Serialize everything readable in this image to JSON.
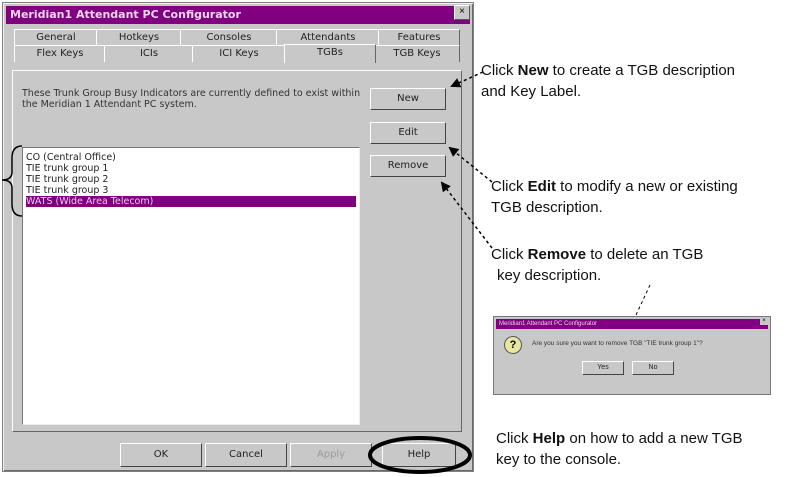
{
  "window": {
    "title": "Meridian1 Attendant PC Configurator",
    "close": "×"
  },
  "tabs_back": [
    "General",
    "Hotkeys",
    "Consoles",
    "Attendants",
    "Features"
  ],
  "tabs_front": [
    "Flex Keys",
    "ICIs",
    "ICI Keys",
    "TGBs",
    "TGB Keys"
  ],
  "active_tab": "TGBs",
  "description": "These Trunk Group Busy Indicators are currently defined to exist within the Meridian 1 Attendant PC system.",
  "side_buttons": {
    "new": "New",
    "edit": "Edit",
    "remove": "Remove"
  },
  "list_items": [
    "CO (Central Office)",
    "TIE trunk group 1",
    "TIE trunk group 2",
    "TIE trunk group 3",
    "WATS (Wide Area Telecom)"
  ],
  "selected_item": "WATS (Wide Area Telecom)",
  "bottom_buttons": {
    "ok": "OK",
    "cancel": "Cancel",
    "apply": "Apply",
    "help": "Help"
  },
  "callouts": {
    "new": {
      "pre": "Click ",
      "bold": "New",
      "post": " to create a TGB description",
      "line2": "and Key Label."
    },
    "edit": {
      "pre": "Click ",
      "bold": "Edit",
      "post": " to modify a new or existing",
      "line2": "TGB description."
    },
    "remove": {
      "pre": "Click ",
      "bold": "Remove",
      "post": " to delete an TGB",
      "line2": "key description."
    },
    "help": {
      "pre": "Click ",
      "bold": "Help",
      "post": " on how to add a new TGB",
      "line2": "key to the console."
    }
  },
  "confirm_dialog": {
    "title": "Meridian1 Attendant PC Configurator",
    "icon": "?",
    "message": "Are you sure you want to remove TGB \"TIE trunk group 1\"?",
    "yes": "Yes",
    "no": "No"
  },
  "colors": {
    "accent": "#800080",
    "dialog_bg": "#c8c8c8"
  }
}
